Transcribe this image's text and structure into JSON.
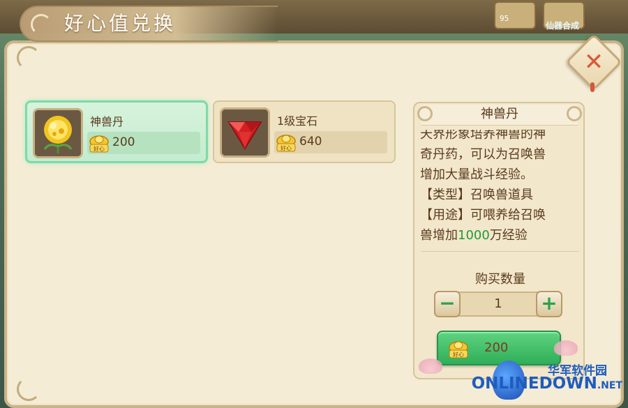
{
  "title": "好心值兑换",
  "hud": {
    "count": "95",
    "tag": "仙器合成"
  },
  "items": [
    {
      "name": "神兽丹",
      "currency": "好心",
      "price": "200",
      "selected": true,
      "icon": "golden-flower-pill"
    },
    {
      "name": "1级宝石",
      "currency": "好心",
      "price": "640",
      "selected": false,
      "icon": "red-gem"
    }
  ],
  "detail": {
    "title": "神兽丹",
    "desc_lines": [
      "天界形象培养神兽的神",
      "奇丹药，可以为召唤兽",
      "增加大量战斗经验。",
      "【类型】召唤兽道具",
      "【用途】可喂养给召唤",
      "兽增加"
    ],
    "desc_highlight": "1000",
    "desc_tail": "万经验",
    "qty_label": "购买数量",
    "quantity": "1",
    "buy_currency": "好心",
    "buy_price": "200"
  },
  "close_icon": "close-icon",
  "watermark": {
    "cn": "华军软件园",
    "en": "ONLINEDOWN",
    "suffix": ".NET"
  },
  "colors": {
    "accent_green": "#1f9b3a",
    "price_brown": "#5a3b1e",
    "close_red": "#d65a3a"
  }
}
